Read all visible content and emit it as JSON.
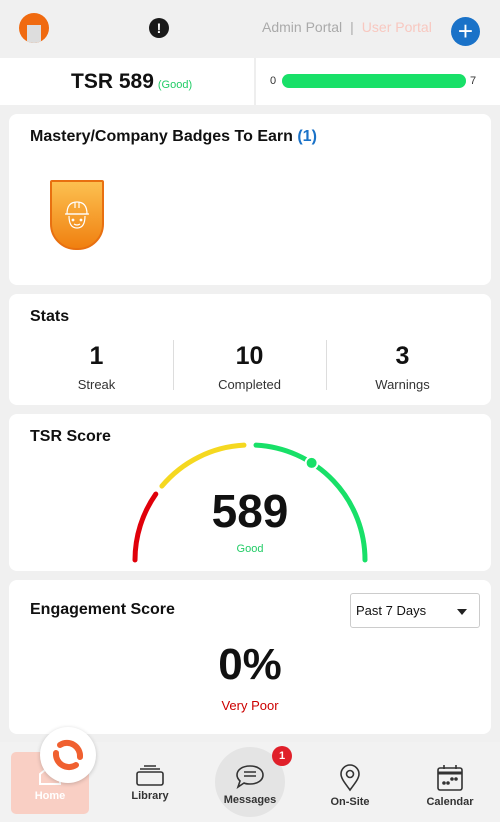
{
  "header": {
    "admin_portal": "Admin Portal",
    "separator": "|",
    "user_portal": "User Portal",
    "alert_icon": "!",
    "add_icon": "+"
  },
  "tsr_bar": {
    "label": "TSR 589",
    "status": "(Good)",
    "progress_min": "0",
    "progress_max": "7",
    "progress_fraction": 1.0
  },
  "badges": {
    "title": "Mastery/Company Badges To Earn",
    "count": "(1)",
    "items": [
      {
        "icon": "hard-hat-worker-icon",
        "color": "#f59020"
      }
    ]
  },
  "stats": {
    "title": "Stats",
    "items": [
      {
        "value": "1",
        "label": "Streak"
      },
      {
        "value": "10",
        "label": "Completed"
      },
      {
        "value": "3",
        "label": "Warnings"
      }
    ]
  },
  "tsr_score": {
    "title": "TSR Score",
    "value": "589",
    "status": "Good",
    "marker_fraction": 0.68,
    "colors": {
      "poor": "#e0000a",
      "fair": "#f5d820",
      "good": "#18e068"
    }
  },
  "engagement": {
    "title": "Engagement Score",
    "period": "Past 7 Days",
    "value": "0%",
    "status": "Very Poor"
  },
  "nav": {
    "items": [
      {
        "label": "Home"
      },
      {
        "label": "Library"
      },
      {
        "label": "Messages",
        "badge": "1"
      },
      {
        "label": "On-Site"
      },
      {
        "label": "Calendar"
      }
    ]
  },
  "colors": {
    "accent": "#1a72c8",
    "brand": "#f06030",
    "good": "#22cc66",
    "bad": "#cc0000"
  }
}
